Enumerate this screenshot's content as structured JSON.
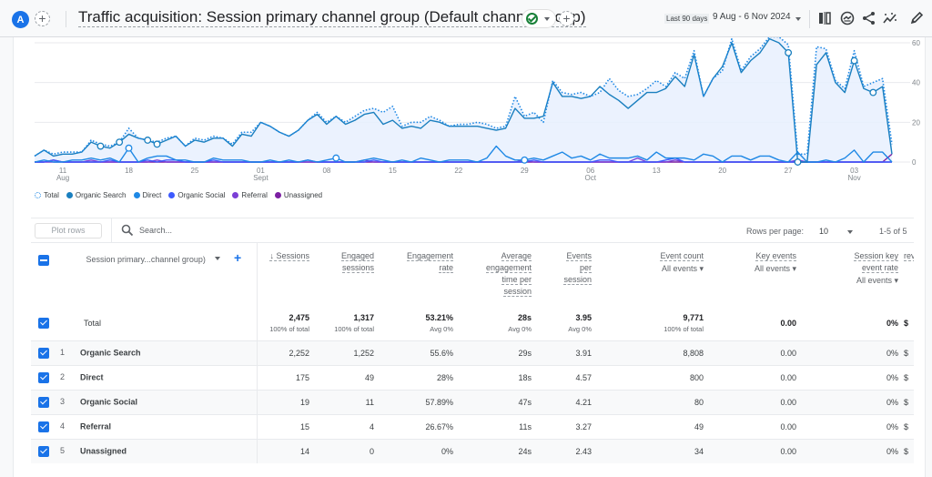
{
  "header": {
    "avatar_letter": "A",
    "title": "Traffic acquisition: Session primary channel group (Default channel group)",
    "date_preset": "Last 90 days",
    "date_range": "9 Aug - 6 Nov 2024"
  },
  "toolbar_icons": [
    "compare-icon",
    "insights-icon",
    "share-icon",
    "trend-icon",
    "edit-icon"
  ],
  "legend": [
    {
      "label": "Total",
      "color": "#1e88e5",
      "hollow": true
    },
    {
      "label": "Organic Search",
      "color": "#1a7fbf"
    },
    {
      "label": "Direct",
      "color": "#1e88e5"
    },
    {
      "label": "Organic Social",
      "color": "#3d5afe"
    },
    {
      "label": "Referral",
      "color": "#7b3fd6"
    },
    {
      "label": "Unassigned",
      "color": "#7b1fa2"
    }
  ],
  "chart_data": {
    "type": "line",
    "x_start": "2024-08-08",
    "x_ticks": [
      {
        "day": 3,
        "label": "11",
        "sub": "Aug"
      },
      {
        "day": 10,
        "label": "18",
        "sub": ""
      },
      {
        "day": 17,
        "label": "25",
        "sub": ""
      },
      {
        "day": 24,
        "label": "01",
        "sub": "Sept"
      },
      {
        "day": 31,
        "label": "08",
        "sub": ""
      },
      {
        "day": 38,
        "label": "15",
        "sub": ""
      },
      {
        "day": 45,
        "label": "22",
        "sub": ""
      },
      {
        "day": 52,
        "label": "29",
        "sub": ""
      },
      {
        "day": 59,
        "label": "06",
        "sub": "Oct"
      },
      {
        "day": 66,
        "label": "13",
        "sub": ""
      },
      {
        "day": 73,
        "label": "20",
        "sub": ""
      },
      {
        "day": 80,
        "label": "27",
        "sub": ""
      },
      {
        "day": 87,
        "label": "03",
        "sub": "Nov"
      }
    ],
    "y_ticks": [
      0,
      20,
      40,
      60
    ],
    "ylim": [
      0,
      60
    ],
    "grid": true,
    "legend_position": "bottom-left",
    "series": [
      {
        "name": "Total",
        "style": "dotted",
        "color": "#1e88e5",
        "values": [
          3,
          6,
          4,
          5,
          5,
          5,
          11,
          9,
          8,
          10,
          17,
          12,
          11,
          10,
          12,
          13,
          8,
          12,
          11,
          13,
          12,
          9,
          15,
          15,
          20,
          18,
          15,
          13,
          16,
          21,
          25,
          20,
          23,
          20,
          23,
          26,
          27,
          25,
          28,
          18,
          20,
          20,
          23,
          21,
          18,
          19,
          19,
          20,
          19,
          17,
          18,
          33,
          23,
          25,
          20,
          41,
          35,
          34,
          35,
          33,
          35,
          42,
          36,
          33,
          34,
          37,
          41,
          38,
          45,
          42,
          56,
          33,
          42,
          46,
          62,
          46,
          53,
          57,
          63,
          63,
          59,
          4,
          4,
          58,
          57,
          41,
          37,
          56,
          38,
          40,
          42,
          9
        ]
      },
      {
        "name": "Organic Search",
        "style": "solid",
        "color": "#1a7fbf",
        "values": [
          3,
          6,
          3,
          4,
          4,
          5,
          10,
          8,
          7,
          10,
          14,
          12,
          11,
          9,
          11,
          13,
          8,
          11,
          10,
          12,
          12,
          8,
          14,
          13,
          20,
          18,
          15,
          13,
          16,
          21,
          24,
          19,
          23,
          19,
          21,
          24,
          25,
          19,
          21,
          17,
          18,
          17,
          21,
          20,
          18,
          18,
          18,
          18,
          17,
          16,
          17,
          27,
          22,
          22,
          23,
          40,
          33,
          33,
          32,
          33,
          38,
          34,
          31,
          27,
          31,
          35,
          35,
          37,
          43,
          38,
          54,
          33,
          42,
          48,
          60,
          45,
          51,
          55,
          62,
          60,
          55,
          0,
          0,
          49,
          55,
          40,
          35,
          51,
          37,
          35,
          38,
          4
        ]
      },
      {
        "name": "Direct",
        "style": "solid",
        "color": "#1e88e5",
        "values": [
          0,
          1,
          0,
          0,
          1,
          1,
          2,
          1,
          2,
          0,
          7,
          0,
          2,
          3,
          3,
          1,
          1,
          0,
          0,
          2,
          1,
          1,
          1,
          0,
          0,
          1,
          0,
          1,
          0,
          1,
          0,
          1,
          2,
          0,
          0,
          1,
          2,
          1,
          0,
          1,
          0,
          2,
          1,
          0,
          1,
          1,
          1,
          0,
          2,
          8,
          3,
          1,
          1,
          2,
          1,
          3,
          5,
          2,
          3,
          1,
          4,
          2,
          2,
          2,
          3,
          1,
          5,
          2,
          2,
          2,
          1,
          4,
          3,
          0,
          3,
          3,
          1,
          3,
          3,
          1,
          0,
          5,
          0,
          0,
          1,
          0,
          2,
          6,
          0,
          5,
          5,
          0
        ]
      },
      {
        "name": "Organic Social",
        "style": "solid",
        "color": "#3d5afe",
        "values": [
          0,
          0,
          1,
          0,
          0,
          0,
          0,
          0,
          1,
          0,
          0,
          0,
          1,
          0,
          1,
          1,
          0,
          0,
          0,
          1,
          0,
          0,
          0,
          0,
          0,
          0,
          0,
          0,
          0,
          1,
          0,
          0,
          0,
          0,
          0,
          0,
          1,
          0,
          0,
          0,
          0,
          0,
          0,
          0,
          0,
          0,
          0,
          0,
          0,
          0,
          0,
          0,
          0,
          1,
          0,
          0,
          0,
          0,
          0,
          0,
          1,
          1,
          0,
          0,
          0,
          0,
          0,
          1,
          2,
          0,
          0,
          0,
          0,
          0,
          0,
          0,
          0,
          0,
          0,
          0,
          0,
          0,
          0,
          0,
          0,
          0,
          0,
          0,
          0,
          0,
          0,
          0
        ]
      },
      {
        "name": "Referral",
        "style": "solid",
        "color": "#7b3fd6",
        "values": [
          0,
          0,
          0,
          0,
          0,
          0,
          1,
          0,
          0,
          0,
          0,
          0,
          0,
          1,
          0,
          0,
          0,
          0,
          0,
          0,
          0,
          0,
          0,
          0,
          0,
          0,
          0,
          0,
          0,
          0,
          0,
          0,
          0,
          0,
          0,
          1,
          0,
          0,
          0,
          0,
          0,
          0,
          0,
          0,
          0,
          0,
          0,
          0,
          0,
          0,
          0,
          0,
          1,
          0,
          0,
          0,
          0,
          0,
          0,
          0,
          0,
          0,
          0,
          0,
          2,
          0,
          0,
          0,
          1,
          0,
          0,
          0,
          0,
          0,
          0,
          0,
          0,
          0,
          0,
          0,
          0,
          1,
          0,
          0,
          0,
          0,
          0,
          0,
          0,
          0,
          0,
          0
        ]
      },
      {
        "name": "Unassigned",
        "style": "solid",
        "color": "#7b1fa2",
        "values": [
          0,
          0,
          1,
          0,
          0,
          0,
          0,
          0,
          0,
          0,
          0,
          0,
          0,
          0,
          0,
          0,
          0,
          0,
          0,
          0,
          0,
          0,
          0,
          0,
          0,
          0,
          0,
          0,
          0,
          0,
          0,
          0,
          0,
          0,
          0,
          0,
          0,
          0,
          0,
          0,
          0,
          0,
          0,
          0,
          0,
          0,
          0,
          0,
          0,
          0,
          0,
          0,
          0,
          0,
          0,
          0,
          0,
          0,
          0,
          0,
          0,
          0,
          0,
          0,
          0,
          0,
          0,
          0,
          0,
          0,
          0,
          0,
          0,
          0,
          0,
          0,
          0,
          0,
          0,
          0,
          0,
          0,
          0,
          0,
          0,
          0,
          0,
          0,
          0,
          0,
          0,
          4
        ]
      }
    ],
    "markers": [
      {
        "series": "Organic Search",
        "days": [
          7,
          9,
          12,
          13,
          80,
          81,
          87,
          89
        ]
      },
      {
        "series": "Direct",
        "days": [
          10,
          32,
          52
        ]
      }
    ]
  },
  "table_toolbar": {
    "plot_rows_label": "Plot rows",
    "search_placeholder": "Search...",
    "rows_per_page_label": "Rows per page:",
    "rows_per_page_value": "10",
    "pagination": "1-5 of 5"
  },
  "table": {
    "dimension_header": "Session primary...channel group)",
    "columns": [
      {
        "label_lines": [
          "↓ Sessions"
        ],
        "sub": ""
      },
      {
        "label_lines": [
          "Engaged",
          "sessions"
        ],
        "sub": ""
      },
      {
        "label_lines": [
          "Engagement",
          "rate"
        ],
        "sub": ""
      },
      {
        "label_lines": [
          "Average",
          "engagement",
          "time per",
          "session"
        ],
        "sub": ""
      },
      {
        "label_lines": [
          "Events",
          "per",
          "session"
        ],
        "sub": ""
      },
      {
        "label_lines": [
          "Event count"
        ],
        "sub": "All events"
      },
      {
        "label_lines": [
          "Key events"
        ],
        "sub": "All events"
      },
      {
        "label_lines": [
          "Session key",
          "event rate"
        ],
        "sub": "All events"
      },
      {
        "label_lines": [
          "rev"
        ],
        "sub": ""
      }
    ],
    "total": {
      "label": "Total",
      "values": [
        "2,475",
        "1,317",
        "53.21%",
        "28s",
        "3.95",
        "9,771",
        "0.00",
        "0%",
        "$"
      ],
      "subs": [
        "100% of total",
        "100% of total",
        "Avg 0%",
        "Avg 0%",
        "Avg 0%",
        "100% of total",
        "",
        "",
        ""
      ]
    },
    "rows": [
      {
        "rank": "1",
        "name": "Organic Search",
        "values": [
          "2,252",
          "1,252",
          "55.6%",
          "29s",
          "3.91",
          "8,808",
          "0.00",
          "0%",
          "$"
        ]
      },
      {
        "rank": "2",
        "name": "Direct",
        "values": [
          "175",
          "49",
          "28%",
          "18s",
          "4.57",
          "800",
          "0.00",
          "0%",
          "$"
        ]
      },
      {
        "rank": "3",
        "name": "Organic Social",
        "values": [
          "19",
          "11",
          "57.89%",
          "47s",
          "4.21",
          "80",
          "0.00",
          "0%",
          "$"
        ]
      },
      {
        "rank": "4",
        "name": "Referral",
        "values": [
          "15",
          "4",
          "26.67%",
          "11s",
          "3.27",
          "49",
          "0.00",
          "0%",
          "$"
        ]
      },
      {
        "rank": "5",
        "name": "Unassigned",
        "values": [
          "14",
          "0",
          "0%",
          "24s",
          "2.43",
          "34",
          "0.00",
          "0%",
          "$"
        ]
      }
    ]
  }
}
